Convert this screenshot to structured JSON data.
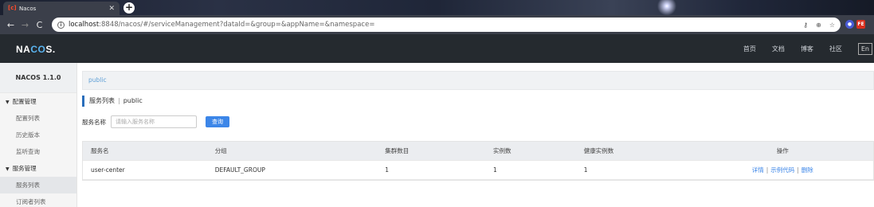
{
  "browser": {
    "tab_title": "Nacos",
    "tab_favicon": "[c]",
    "url_host": "localhost",
    "url_rest": ":8848/nacos/#/serviceManagement?dataId=&group=&appName=&namespace=",
    "ext_icons": [
      "key-icon",
      "zoom-icon",
      "star-icon"
    ]
  },
  "header": {
    "logo_prefix": "NA",
    "logo_accent": "CO",
    "logo_suffix": "S.",
    "nav": [
      "首页",
      "文档",
      "博客",
      "社区"
    ],
    "lang": "En"
  },
  "sidebar": {
    "version": "NACOS 1.1.0",
    "config_group": "配置管理",
    "config_items": [
      "配置列表",
      "历史版本",
      "监听查询"
    ],
    "service_group": "服务管理",
    "service_items": [
      "服务列表",
      "订阅者列表"
    ]
  },
  "main": {
    "namespace": "public",
    "title": "服务列表",
    "title_ns": "public",
    "search_label": "服务名称",
    "search_placeholder": "请输入服务名称",
    "search_button": "查询",
    "columns": [
      "服务名",
      "分组",
      "集群数目",
      "实例数",
      "健康实例数",
      "操作"
    ],
    "rows": [
      {
        "name": "user-center",
        "group": "DEFAULT_GROUP",
        "clusters": "1",
        "instances": "1",
        "healthy": "1",
        "op_detail": "详情",
        "op_sample": "示例代码",
        "op_delete": "删除"
      }
    ]
  },
  "colors": {
    "header_bg": "#252a2f",
    "accent": "#3c86e8",
    "title_bar": "#2a6ebb"
  }
}
